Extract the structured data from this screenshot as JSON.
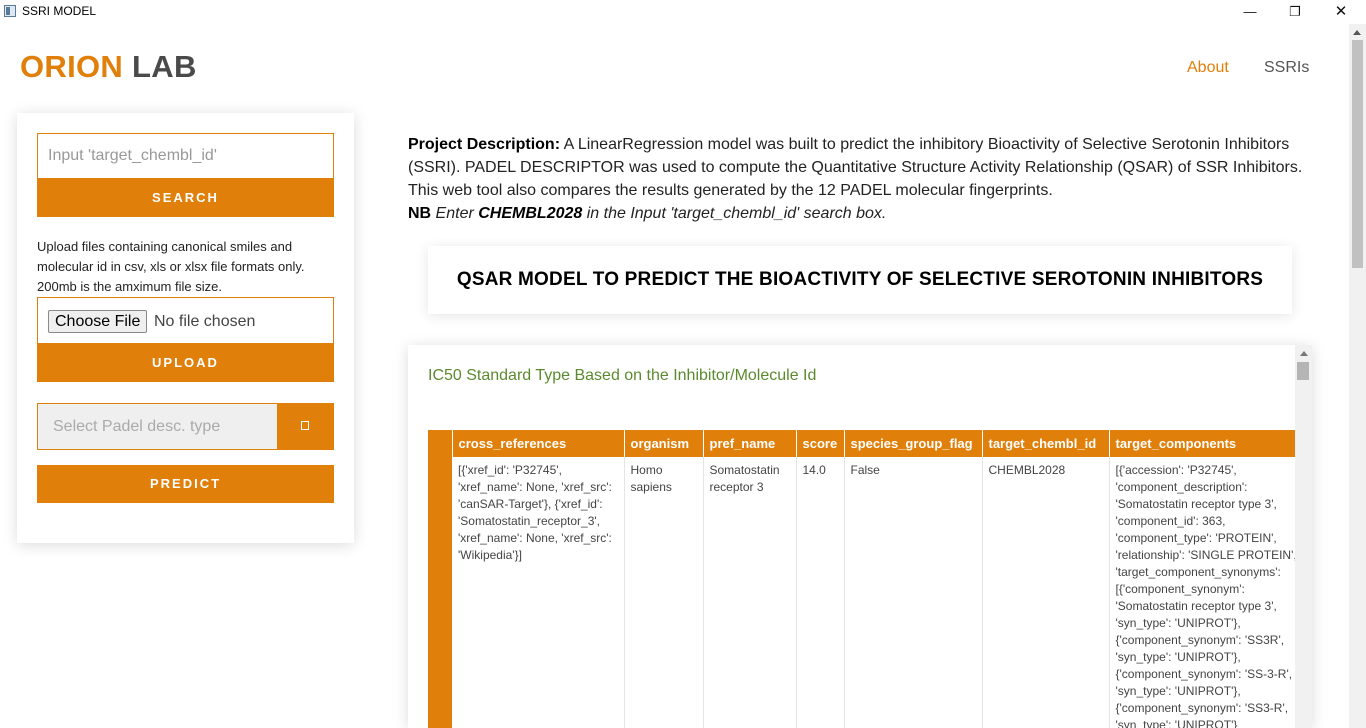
{
  "window": {
    "title": "SSRI MODEL",
    "minimize": "—",
    "restore": "❐",
    "close": "✕"
  },
  "header": {
    "logo_orion": "ORION",
    "logo_lab": "LAB",
    "nav": {
      "about": "About",
      "ssris": "SSRIs"
    }
  },
  "sidebar": {
    "search_placeholder": "Input 'target_chembl_id'",
    "search_button": "SEARCH",
    "upload_text": "Upload files containing canonical smiles and molecular id in csv, xls or xlsx file formats only. 200mb is the amximum file size.",
    "choose_file_button": "Choose File",
    "no_file_text": "No file chosen",
    "upload_button": "UPLOAD",
    "select_placeholder": "Select Padel desc. type",
    "select_button_icon": "□",
    "predict_button": "PREDICT"
  },
  "description": {
    "label": "Project Description:",
    "text": " A LinearRegression model was built to predict the inhibitory Bioactivity of Selective Serotonin Inhibitors (SSRI). PADEL DESCRIPTOR was used to compute the Quantitative Structure Activity Relationship (QSAR) of SSR Inhibitors. This web tool also compares the results generated by the 12 PADEL molecular fingerprints.",
    "nb_label": "NB",
    "nb_pre": " Enter ",
    "nb_id": "CHEMBL2028",
    "nb_post": " in the Input 'target_chembl_id' search box."
  },
  "heading": "QSAR MODEL TO PREDICT THE BIOACTIVITY OF SELECTIVE SEROTONIN INHIBITORS",
  "table": {
    "title": "IC50 Standard Type Based on the Inhibitor/Molecule Id",
    "columns": [
      "",
      "cross_references",
      "organism",
      "pref_name",
      "score",
      "species_group_flag",
      "target_chembl_id",
      "target_components"
    ],
    "rows": [
      [
        "",
        "[{'xref_id': 'P32745', 'xref_name': None, 'xref_src': 'canSAR-Target'}, {'xref_id': 'Somatostatin_receptor_3', 'xref_name': None, 'xref_src': 'Wikipedia'}]",
        "Homo sapiens",
        "Somatostatin receptor 3",
        "14.0",
        "False",
        "CHEMBL2028",
        "[{'accession': 'P32745', 'component_description': 'Somatostatin receptor type 3', 'component_id': 363, 'component_type': 'PROTEIN', 'relationship': 'SINGLE PROTEIN', 'target_component_synonyms': [{'component_synonym': 'Somatostatin receptor type 3', 'syn_type': 'UNIPROT'}, {'component_synonym': 'SS3R', 'syn_type': 'UNIPROT'}, {'component_synonym': 'SS-3-R', 'syn_type': 'UNIPROT'}, {'component_synonym': 'SS3-R', 'syn_type': 'UNIPROT'}"
      ]
    ]
  },
  "colors": {
    "accent": "#e07f0a",
    "table_title": "#5b8a2e"
  }
}
